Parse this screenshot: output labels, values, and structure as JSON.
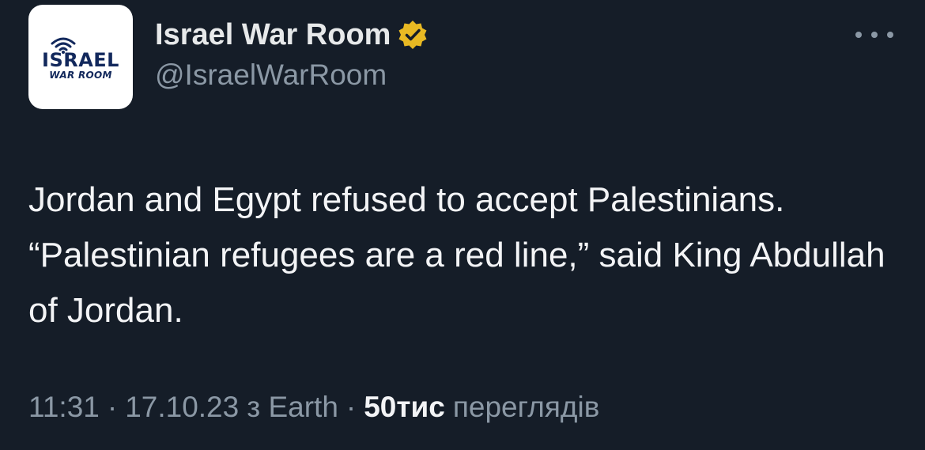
{
  "account": {
    "display_name": "Israel War Room",
    "handle": "@IsraelWarRoom",
    "verified_icon": "verified-badge-gold",
    "avatar": {
      "logo_main": "ISRAEL",
      "logo_sub": "WAR ROOM",
      "icon": "wifi-signal-icon"
    }
  },
  "tweet": {
    "text": "Jordan and Egypt refused to accept Palestinians. “Palestinian refugees are a red line,” said King Abdullah of Jordan.",
    "time": "11:31",
    "separator": "·",
    "date": "17.10.23",
    "source": "з Earth",
    "views_count": "50тис",
    "views_label": "переглядів"
  },
  "colors": {
    "background": "#151d28",
    "text": "#e7e9ea",
    "secondary": "#8b98a5",
    "verified_gold": "#e8b923",
    "logo_navy": "#12285c"
  }
}
